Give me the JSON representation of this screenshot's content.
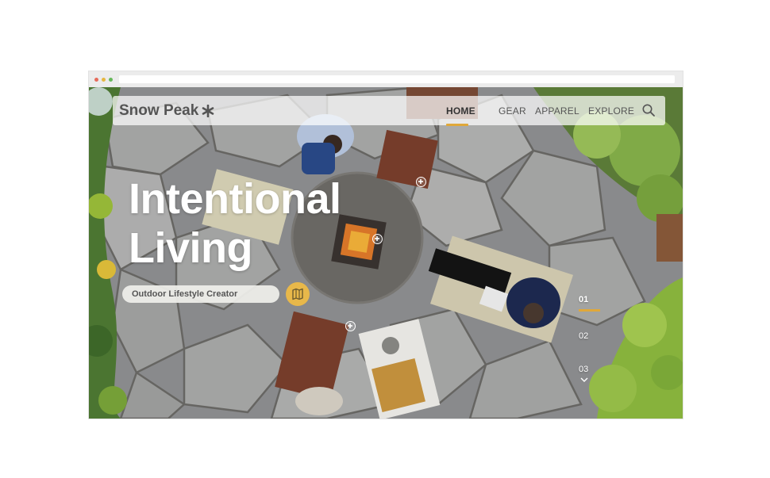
{
  "brand": {
    "name": "Snow Peak",
    "logo_icon": "asterisk-star-icon"
  },
  "nav": {
    "items": [
      {
        "label": "HOME",
        "active": true
      },
      {
        "label": "GEAR",
        "active": false
      },
      {
        "label": "APPAREL",
        "active": false
      },
      {
        "label": "EXPLORE",
        "active": false
      }
    ],
    "search_icon": "search-icon",
    "accent_color": "#e0a83a"
  },
  "hero": {
    "title_line1": "Intentional",
    "title_line2": "Living",
    "subtitle": "Outdoor Lifestyle Creator",
    "map_icon": "map-icon"
  },
  "slides": {
    "items": [
      "01",
      "02",
      "03"
    ],
    "active_index": 0,
    "scroll_icon": "chevron-down-icon"
  },
  "hotspots": {
    "icon": "plus-circle-icon",
    "count": 4
  }
}
